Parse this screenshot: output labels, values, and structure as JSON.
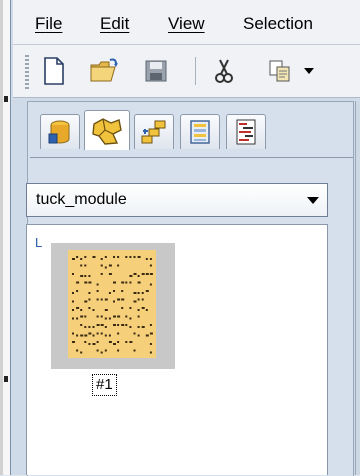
{
  "menubar": {
    "items": [
      {
        "label": "File",
        "accel": "F",
        "rest": "ile"
      },
      {
        "label": "Edit",
        "accel": "E",
        "rest": "dit"
      },
      {
        "label": "View",
        "accel": "V",
        "rest": "iew"
      },
      {
        "label": "Selection",
        "accel": "",
        "rest": "Selection"
      }
    ]
  },
  "toolbar": {
    "buttons": [
      "new-document-icon",
      "open-folder-icon",
      "save-icon",
      "cut-icon",
      "copy-icon",
      "dropdown-arrow-icon"
    ]
  },
  "tabs": [
    {
      "icon": "database-icon"
    },
    {
      "icon": "module-group-icon",
      "active": true
    },
    {
      "icon": "hierarchy-icon"
    },
    {
      "icon": "list-icon"
    },
    {
      "icon": "signal-bars-icon"
    }
  ],
  "dropdown": {
    "value": "tuck_module"
  },
  "items": [
    {
      "corner": "L",
      "label": "#1"
    }
  ],
  "colors": {
    "accent": "#2a5fa8",
    "thumbnail": "#f6cf7a",
    "frame": "#cfdbe9"
  }
}
